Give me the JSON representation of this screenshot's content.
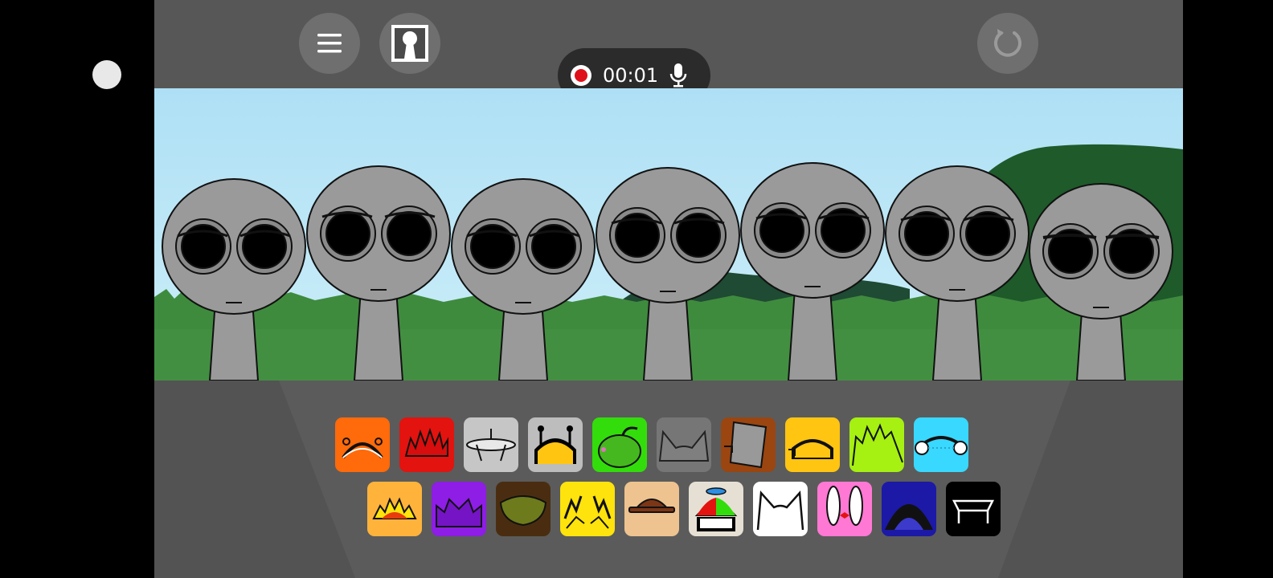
{
  "recorder": {
    "time": "00:01"
  },
  "icons": {
    "menu": "hamburger-menu-icon",
    "character": "keyhole-character-icon",
    "reset": "refresh-icon",
    "record": "record-icon",
    "mic": "microphone-icon"
  },
  "colors": {
    "sky": "#aee0f5",
    "grass": "#3f8b3e",
    "hills": "#1f5a2a",
    "character": "#9a9a9a",
    "topbar": "#575757",
    "record": "#e0101a"
  },
  "sounds": {
    "row1": [
      {
        "name": "orange-antenna-sound",
        "color": "#ff6a0a"
      },
      {
        "name": "red-spiky-sound",
        "color": "#e3130f"
      },
      {
        "name": "silver-saucer-sound",
        "color": "#c6c6c6"
      },
      {
        "name": "gray-robot-sound",
        "color": "#bdbdbd"
      },
      {
        "name": "green-pepper-sound",
        "color": "#33dd0b"
      },
      {
        "name": "gray-cat-ears-sound",
        "color": "#767676"
      },
      {
        "name": "brown-bucket-sound",
        "color": "#9b4510"
      },
      {
        "name": "yellow-cap-sound",
        "color": "#ffc511"
      },
      {
        "name": "lime-spiky-sound",
        "color": "#a6f012"
      },
      {
        "name": "cyan-headphones-sound",
        "color": "#39d8ff"
      }
    ],
    "row2": [
      {
        "name": "orange-sun-sound",
        "color": "#ffb33b"
      },
      {
        "name": "purple-horns-sound",
        "color": "#8e1de6"
      },
      {
        "name": "brown-nest-sound",
        "color": "#4a2d10"
      },
      {
        "name": "yellow-lightning-sound",
        "color": "#ffe30c"
      },
      {
        "name": "tan-hat-sound",
        "color": "#eec38f"
      },
      {
        "name": "propeller-cap-sound",
        "color": "#e6e0d4"
      },
      {
        "name": "white-cat-sound",
        "color": "#ffffff"
      },
      {
        "name": "pink-bunny-sound",
        "color": "#ff78d4"
      },
      {
        "name": "navy-dome-sound",
        "color": "#1c19a6"
      },
      {
        "name": "black-frame-sound",
        "color": "#000000"
      }
    ]
  }
}
